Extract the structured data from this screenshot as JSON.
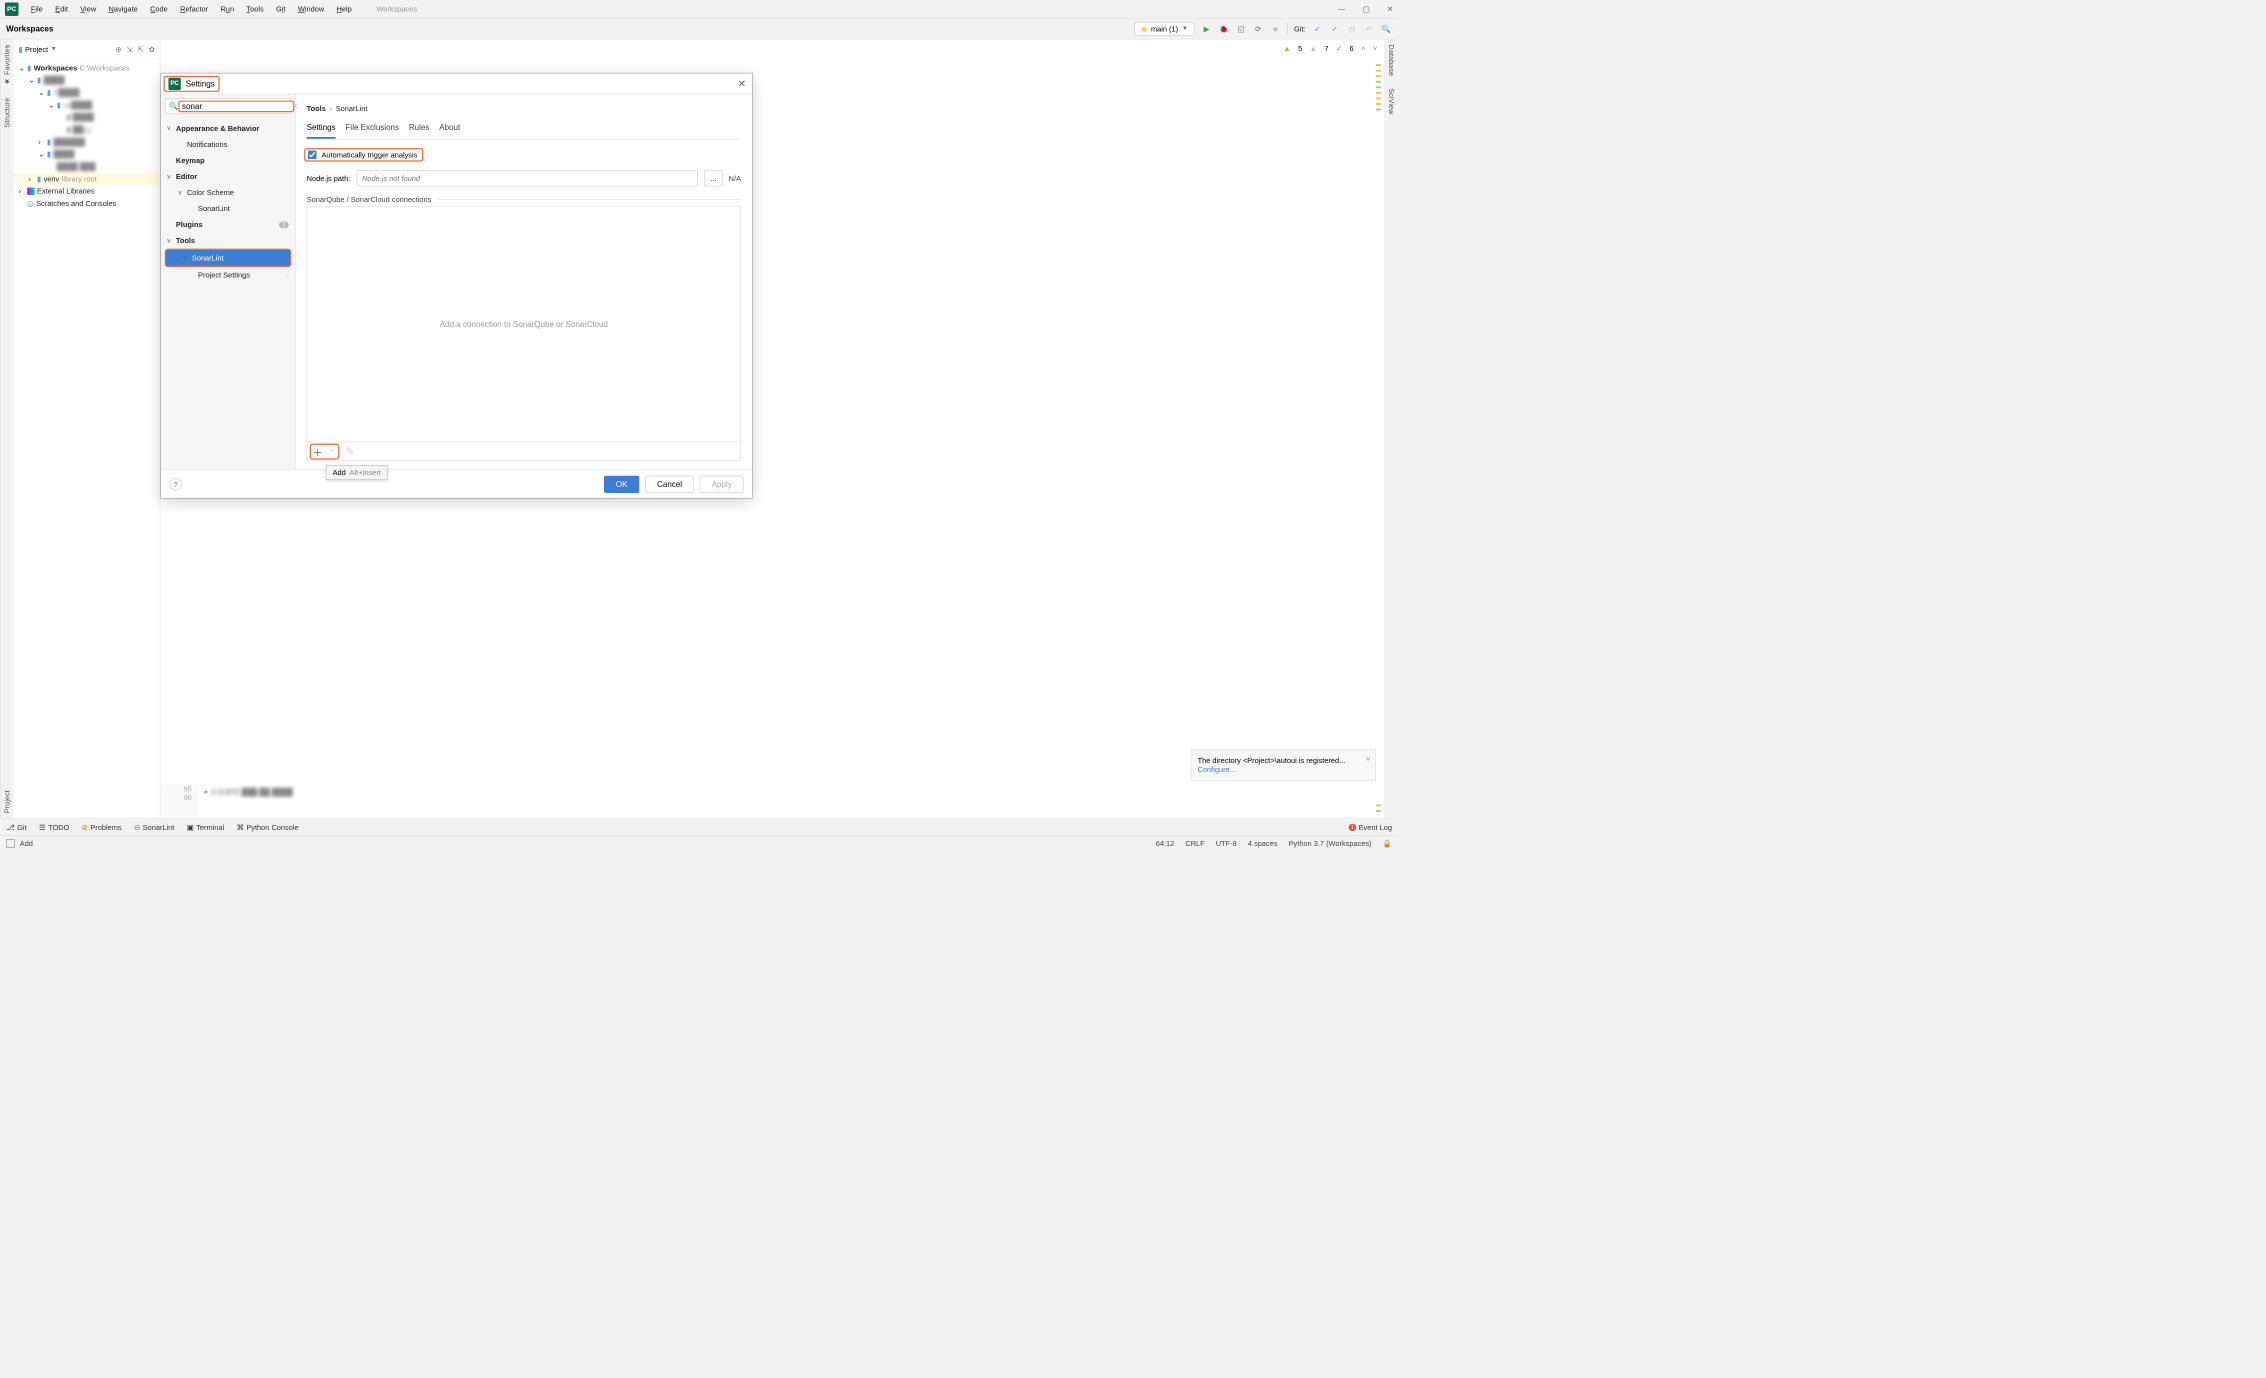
{
  "menubar": {
    "items": [
      "File",
      "Edit",
      "View",
      "Navigate",
      "Code",
      "Refactor",
      "Run",
      "Tools",
      "Git",
      "Window",
      "Help"
    ],
    "tab": "Workspaces"
  },
  "window_controls": {
    "min": "—",
    "max": "▢",
    "close": "✕"
  },
  "toolbar": {
    "crumb": "Workspaces",
    "run_config": "main (1)",
    "git_label": "Git:"
  },
  "project_panel": {
    "title": "Project",
    "root": {
      "name": "Workspaces",
      "path": "C:\\Workspaces"
    },
    "venv": "venv",
    "venv_suffix": "library root",
    "ext_lib": "External Libraries",
    "scratch": "Scratches and Consoles"
  },
  "inspections": {
    "warn_count": "5",
    "weak_count": "7",
    "check_count": "6"
  },
  "dialog": {
    "title": "Settings",
    "search_value": "sonar",
    "breadcrumb": [
      "Tools",
      "SonarLint"
    ],
    "subtabs": [
      "Settings",
      "File Exclusions",
      "Rules",
      "About"
    ],
    "auto_trigger_label": "Automatically trigger analysis",
    "auto_trigger_checked": true,
    "node_label": "Node.js path:",
    "node_placeholder": "Node.js not found",
    "node_browse": "...",
    "node_na": "N/A",
    "connections_label": "SonarQube / SonarCloud connections",
    "connections_empty": "Add a connection to SonarQube or SonarCloud",
    "tooltip_label": "Add",
    "tooltip_shortcut": "Alt+Insert",
    "buttons": {
      "ok": "OK",
      "cancel": "Cancel",
      "apply": "Apply"
    },
    "sidebar": [
      {
        "label": "Appearance & Behavior",
        "bold": true,
        "caret": "v",
        "indent": 0
      },
      {
        "label": "Notifications",
        "indent": 1
      },
      {
        "label": "Keymap",
        "bold": true,
        "indent": 0
      },
      {
        "label": "Editor",
        "bold": true,
        "caret": "v",
        "indent": 0
      },
      {
        "label": "Color Scheme",
        "caret": "v",
        "indent": 1
      },
      {
        "label": "SonarLint",
        "indent": 2
      },
      {
        "label": "Plugins",
        "bold": true,
        "indent": 0,
        "badge": "1"
      },
      {
        "label": "Tools",
        "bold": true,
        "caret": "v",
        "indent": 0
      },
      {
        "label": "SonarLint",
        "caret": "v",
        "indent": 1,
        "selected": true,
        "hilite": true
      },
      {
        "label": "Project Settings",
        "indent": 2,
        "proj": true
      }
    ]
  },
  "notif": {
    "line1": "The directory <Project>\\autoui is registered...",
    "link": "Configure..."
  },
  "bottom_tabs": {
    "git": "Git",
    "todo": "TODO",
    "problems": "Problems",
    "sonarlint": "SonarLint",
    "terminal": "Terminal",
    "pyconsole": "Python Console",
    "event_log": "Event Log"
  },
  "statusbar": {
    "left": "Add",
    "pos": "64:12",
    "sep": "CRLF",
    "enc": "UTF-8",
    "indent": "4 spaces",
    "python": "Python 3.7 (Workspaces)"
  },
  "code": {
    "l1": "95",
    "l2": "96"
  },
  "left_gutter": [
    "Project",
    "Structure",
    "Favorites"
  ],
  "right_gutter": [
    "Database",
    "SciView"
  ]
}
